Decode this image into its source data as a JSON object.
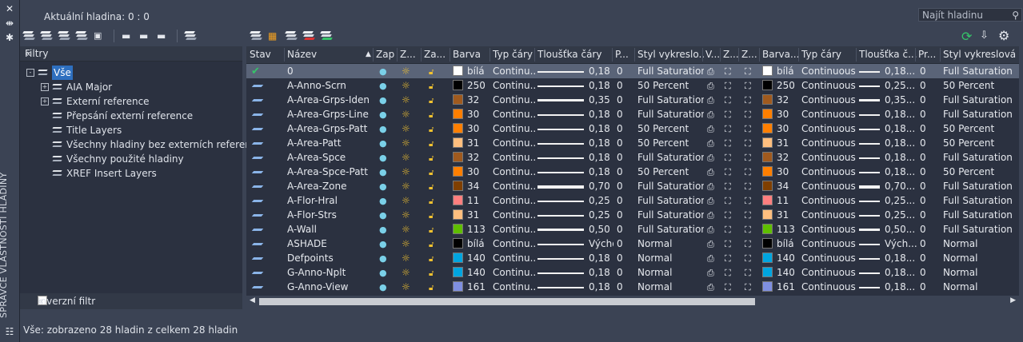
{
  "palette_title": "SPRÁVCE VLASTNOSTÍ HLADINY",
  "current_layer": "Aktuální hladina: 0 : 0",
  "search": {
    "placeholder": "Najít hladinu"
  },
  "filters": {
    "header": "Filtry",
    "items": [
      {
        "label": "Vše",
        "level": 0,
        "expand": "-",
        "selected": true
      },
      {
        "label": "AIA Major",
        "level": 1,
        "expand": "+"
      },
      {
        "label": "Externí reference",
        "level": 1,
        "expand": "+"
      },
      {
        "label": "Přepsání externí reference",
        "level": 1,
        "expand": ""
      },
      {
        "label": "Title Layers",
        "level": 1,
        "expand": ""
      },
      {
        "label": "Všechny hladiny bez externích referencí",
        "level": 1,
        "expand": ""
      },
      {
        "label": "Všechny použité hladiny",
        "level": 1,
        "expand": ""
      },
      {
        "label": "XREF Insert Layers",
        "level": 1,
        "expand": ""
      }
    ],
    "invert_label": "Inverzní filtr"
  },
  "columns": [
    "Stav",
    "Název",
    "Zap",
    "Z...",
    "Za...",
    "Barva",
    "Typ čáry",
    "Tloušťka čáry",
    "P...",
    "Styl vykreslo...",
    "V...",
    "Z...",
    "Z...",
    "Barva...",
    "Typ čáry",
    "Tloušťka č...",
    "Pr...",
    "Styl vykreslová"
  ],
  "rows": [
    {
      "name": "0",
      "color": "#ffffff",
      "color_label": "bílá",
      "ltype": "Continu...",
      "lw_bar": "s",
      "lw": "0,18 mm",
      "p": "0",
      "style": "Full Saturation",
      "vp_color": "#ffffff",
      "vp_color_label": "bílá",
      "vp_ltype": "Continuous",
      "vp_lw": "0,18...",
      "vp_p": "0",
      "vp_style": "Full Saturation",
      "current": true
    },
    {
      "name": "A-Anno-Scrn",
      "color": "#000000",
      "color_label": "250",
      "ltype": "Continu...",
      "lw_bar": "s",
      "lw": "0,18 mm",
      "p": "0",
      "style": "50 Percent",
      "vp_color": "#000000",
      "vp_color_label": "250",
      "vp_ltype": "Continuous",
      "vp_lw": "0,25...",
      "vp_p": "0",
      "vp_style": "50 Percent"
    },
    {
      "name": "A-Area-Grps-Iden",
      "color": "#a05a1e",
      "color_label": "32",
      "ltype": "Continu...",
      "lw_bar": "m",
      "lw": "0,35 mm",
      "p": "0",
      "style": "Full Saturation",
      "vp_color": "#a05a1e",
      "vp_color_label": "32",
      "vp_ltype": "Continuous",
      "vp_lw": "0,35...",
      "vp_p": "0",
      "vp_style": "Full Saturation"
    },
    {
      "name": "A-Area-Grps-Line",
      "color": "#ff7f00",
      "color_label": "30",
      "ltype": "Continu...",
      "lw_bar": "s",
      "lw": "0,18 mm",
      "p": "0",
      "style": "Full Saturation",
      "vp_color": "#ff7f00",
      "vp_color_label": "30",
      "vp_ltype": "Continuous",
      "vp_lw": "0,18...",
      "vp_p": "0",
      "vp_style": "Full Saturation"
    },
    {
      "name": "A-Area-Grps-Patt",
      "color": "#ff7f00",
      "color_label": "30",
      "ltype": "Continu...",
      "lw_bar": "s",
      "lw": "0,18 mm",
      "p": "0",
      "style": "50 Percent",
      "vp_color": "#ff7f00",
      "vp_color_label": "30",
      "vp_ltype": "Continuous",
      "vp_lw": "0,18...",
      "vp_p": "0",
      "vp_style": "50 Percent"
    },
    {
      "name": "A-Area-Patt",
      "color": "#ffbf7f",
      "color_label": "31",
      "ltype": "Continu...",
      "lw_bar": "s",
      "lw": "0,18 mm",
      "p": "0",
      "style": "50 Percent",
      "vp_color": "#ffbf7f",
      "vp_color_label": "31",
      "vp_ltype": "Continuous",
      "vp_lw": "0,18...",
      "vp_p": "0",
      "vp_style": "50 Percent"
    },
    {
      "name": "A-Area-Spce",
      "color": "#a05a1e",
      "color_label": "32",
      "ltype": "Continu...",
      "lw_bar": "s",
      "lw": "0,18 mm",
      "p": "0",
      "style": "Full Saturation",
      "vp_color": "#a05a1e",
      "vp_color_label": "32",
      "vp_ltype": "Continuous",
      "vp_lw": "0,18...",
      "vp_p": "0",
      "vp_style": "Full Saturation"
    },
    {
      "name": "A-Area-Spce-Patt",
      "color": "#ff7f00",
      "color_label": "30",
      "ltype": "Continu...",
      "lw_bar": "s",
      "lw": "0,18 mm",
      "p": "0",
      "style": "50 Percent",
      "vp_color": "#ff7f00",
      "vp_color_label": "30",
      "vp_ltype": "Continuous",
      "vp_lw": "0,18...",
      "vp_p": "0",
      "vp_style": "50 Percent"
    },
    {
      "name": "A-Area-Zone",
      "color": "#7f3f00",
      "color_label": "34",
      "ltype": "Continu...",
      "lw_bar": "l",
      "lw": "0,70 mm",
      "p": "0",
      "style": "Full Saturation",
      "vp_color": "#7f3f00",
      "vp_color_label": "34",
      "vp_ltype": "Continuous",
      "vp_lw": "0,70...",
      "vp_p": "0",
      "vp_style": "Full Saturation"
    },
    {
      "name": "A-Flor-Hral",
      "color": "#ff7f7f",
      "color_label": "11",
      "ltype": "Continu...",
      "lw_bar": "s",
      "lw": "0,25 mm",
      "p": "0",
      "style": "Full Saturation",
      "vp_color": "#ff7f7f",
      "vp_color_label": "11",
      "vp_ltype": "Continuous",
      "vp_lw": "0,25...",
      "vp_p": "0",
      "vp_style": "Full Saturation"
    },
    {
      "name": "A-Flor-Strs",
      "color": "#ffbf7f",
      "color_label": "31",
      "ltype": "Continu...",
      "lw_bar": "s",
      "lw": "0,25 mm",
      "p": "0",
      "style": "Full Saturation",
      "vp_color": "#ffbf7f",
      "vp_color_label": "31",
      "vp_ltype": "Continuous",
      "vp_lw": "0,25...",
      "vp_p": "0",
      "vp_style": "Full Saturation"
    },
    {
      "name": "A-Wall",
      "color": "#5fbf00",
      "color_label": "113",
      "ltype": "Continu...",
      "lw_bar": "m",
      "lw": "0,50 mm",
      "p": "0",
      "style": "Full Saturation",
      "vp_color": "#5fbf00",
      "vp_color_label": "113",
      "vp_ltype": "Continuous",
      "vp_lw": "0,50...",
      "vp_p": "0",
      "vp_style": "Full Saturation"
    },
    {
      "name": "ASHADE",
      "color": "#000000",
      "color_label": "bílá",
      "ltype": "Continu...",
      "lw_bar": "s",
      "lw": "Výchozí",
      "p": "0",
      "style": "Normal",
      "vp_color": "#000000",
      "vp_color_label": "bílá",
      "vp_ltype": "Continuous",
      "vp_lw": "Vých...",
      "vp_p": "0",
      "vp_style": "Normal"
    },
    {
      "name": "Defpoints",
      "color": "#00a5e0",
      "color_label": "140",
      "ltype": "Continu...",
      "lw_bar": "s",
      "lw": "0,18 mm",
      "p": "0",
      "style": "Normal",
      "vp_color": "#00a5e0",
      "vp_color_label": "140",
      "vp_ltype": "Continuous",
      "vp_lw": "0,18...",
      "vp_p": "0",
      "vp_style": "Normal"
    },
    {
      "name": "G-Anno-Nplt",
      "color": "#00a5e0",
      "color_label": "140",
      "ltype": "Continu...",
      "lw_bar": "s",
      "lw": "0,18 mm",
      "p": "0",
      "style": "Normal",
      "vp_color": "#00a5e0",
      "vp_color_label": "140",
      "vp_ltype": "Continuous",
      "vp_lw": "0,18...",
      "vp_p": "0",
      "vp_style": "Normal"
    },
    {
      "name": "G-Anno-View",
      "color": "#7f8fe0",
      "color_label": "161",
      "ltype": "Continu...",
      "lw_bar": "s",
      "lw": "0,18 mm",
      "p": "0",
      "style": "Normal",
      "vp_color": "#7f8fe0",
      "vp_color_label": "161",
      "vp_ltype": "Continuous",
      "vp_lw": "0,18...",
      "vp_p": "0",
      "vp_style": "Normal"
    }
  ],
  "status_text": "Vše: zobrazeno 28 hladin z celkem 28 hladin",
  "icons": {
    "state": "layer-state-icon",
    "current": "check-icon",
    "on": "lightbulb-icon",
    "freeze": "sun-icon",
    "lock": "lock-icon",
    "plot": "printer-icon",
    "refresh": "refresh-icon",
    "settings": "gear-icon",
    "search": "search-icon"
  },
  "colors": {
    "accent_selection": "#2e6fbf",
    "check": "#36c46a"
  }
}
